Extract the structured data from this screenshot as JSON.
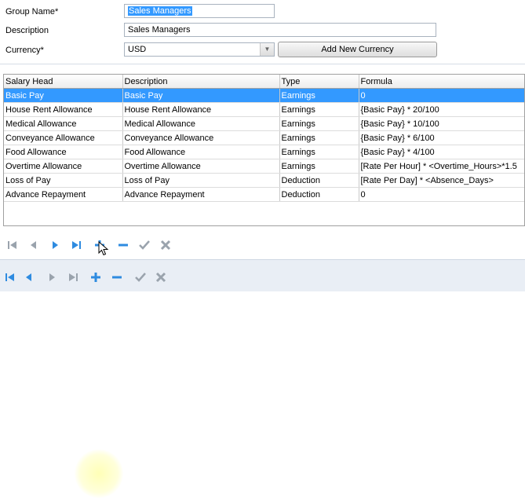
{
  "form": {
    "group_name_label": "Group Name*",
    "group_name_value": "Sales Managers",
    "description_label": "Description",
    "description_value": "Sales Managers",
    "currency_label": "Currency*",
    "currency_value": "USD",
    "add_currency_button": "Add New Currency"
  },
  "grid": {
    "columns": [
      "Salary Head",
      "Description",
      "Type",
      "Formula"
    ],
    "rows": [
      {
        "salary_head": "Basic Pay",
        "description": "Basic Pay",
        "type": "Earnings",
        "formula": "0"
      },
      {
        "salary_head": "House Rent Allowance",
        "description": "House Rent Allowance",
        "type": "Earnings",
        "formula": "{Basic Pay} * 20/100"
      },
      {
        "salary_head": "Medical Allowance",
        "description": "Medical Allowance",
        "type": "Earnings",
        "formula": "{Basic Pay} * 10/100"
      },
      {
        "salary_head": "Conveyance Allowance",
        "description": "Conveyance Allowance",
        "type": "Earnings",
        "formula": "{Basic Pay} * 6/100"
      },
      {
        "salary_head": "Food Allowance",
        "description": "Food Allowance",
        "type": "Earnings",
        "formula": "{Basic Pay} * 4/100"
      },
      {
        "salary_head": "Overtime Allowance",
        "description": "Overtime Allowance",
        "type": "Earnings",
        "formula": "[Rate Per Hour] * <Overtime_Hours>*1.5"
      },
      {
        "salary_head": "Loss of Pay",
        "description": "Loss of Pay",
        "type": "Deduction",
        "formula": "[Rate Per Day] * <Absence_Days>"
      },
      {
        "salary_head": "Advance Repayment",
        "description": "Advance Repayment",
        "type": "Deduction",
        "formula": "0"
      }
    ],
    "selected_row": 0
  },
  "navigators": {
    "icons": [
      "first-record-icon",
      "previous-record-icon",
      "next-record-icon",
      "last-record-icon",
      "add-icon",
      "remove-icon",
      "save-check-icon",
      "cancel-x-icon"
    ],
    "colors": {
      "blue": "#2e8be0",
      "gray": "#9aa3ad",
      "accent_selection": "#3399ff"
    }
  }
}
